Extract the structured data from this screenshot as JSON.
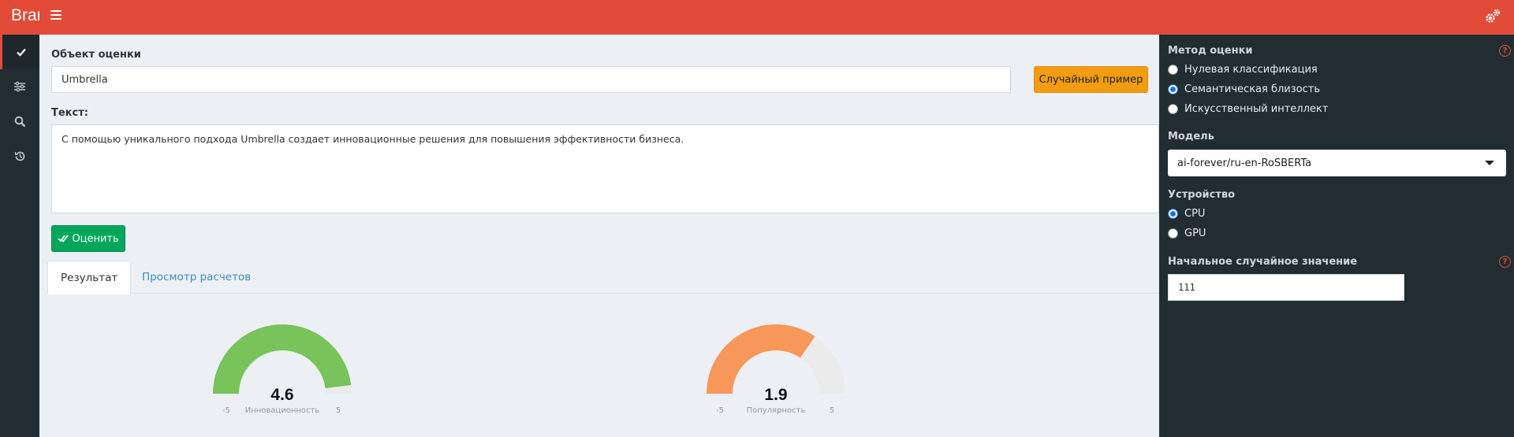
{
  "header": {
    "brand": "Brand",
    "menu_icon": "hamburger-icon",
    "settings_icon": "gears-icon"
  },
  "sidebar": {
    "items": [
      {
        "icon": "check-icon",
        "active": true
      },
      {
        "icon": "sliders-icon",
        "active": false
      },
      {
        "icon": "search-icon",
        "active": false
      },
      {
        "icon": "history-icon",
        "active": false
      }
    ]
  },
  "main": {
    "object_label": "Объект оценки",
    "object_value": "Umbrella",
    "random_button": "Случайный пример",
    "text_label": "Текст:",
    "text_value": "С помощью уникального подхода Umbrella создает инновационные решения для повышения эффективности бизнеса.",
    "evaluate_button": "Оценить",
    "tabs": [
      {
        "label": "Результат"
      },
      {
        "label": "Просмотр расчетов"
      }
    ],
    "gauges": [
      {
        "value": "4.6",
        "value_num": 4.6,
        "label": "Инновационность",
        "min": "-5",
        "max": "5",
        "color": "#78c35a"
      },
      {
        "value": "1.9",
        "value_num": 1.9,
        "label": "Популярность",
        "min": "-5",
        "max": "5",
        "color": "#f7975a"
      }
    ]
  },
  "settings": {
    "method_label": "Метод оценки",
    "methods": [
      {
        "label": "Нулевая классификация",
        "checked": false
      },
      {
        "label": "Семантическая близость",
        "checked": true
      },
      {
        "label": "Искусственный интеллект",
        "checked": false
      }
    ],
    "model_label": "Модель",
    "model_value": "ai-forever/ru-en-RoSBERTa",
    "device_label": "Устройство",
    "devices": [
      {
        "label": "CPU",
        "checked": true
      },
      {
        "label": "GPU",
        "checked": false
      }
    ],
    "seed_label": "Начальное случайное значение",
    "seed_value": "111",
    "help_icon": "help-icon"
  },
  "colors": {
    "header": "#e14b37",
    "sidebar": "#222d32",
    "accent_orange": "#f39c12",
    "accent_green": "#00a65a",
    "link": "#3c8dbc"
  }
}
